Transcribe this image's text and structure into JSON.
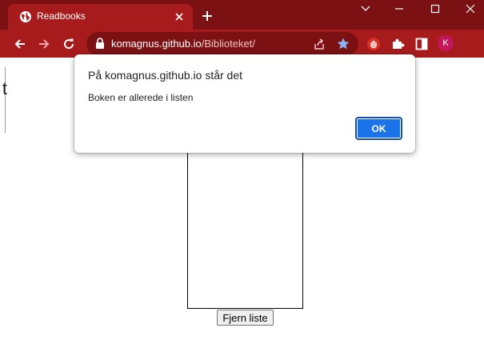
{
  "browser": {
    "tab_title": "Readbooks",
    "url_host": "komagnus.github.io",
    "url_path": "/Biblioteket/",
    "avatar_letter": "K"
  },
  "page": {
    "edge_char": "t",
    "remove_list_button": "Fjern liste"
  },
  "dialog": {
    "title": "På komagnus.github.io står det",
    "message": "Boken er allerede i listen",
    "ok_label": "OK"
  },
  "colors": {
    "titlebar": "#7b1113",
    "toolbar": "#a81b1d",
    "ok_button": "#1a73e8"
  },
  "icons": [
    "globe-icon",
    "close-icon",
    "plus-icon",
    "minimize-icon",
    "maximize-icon",
    "close-window-icon",
    "back-icon",
    "forward-icon",
    "reload-icon",
    "lock-icon",
    "share-icon",
    "star-icon",
    "extension-red-icon",
    "puzzle-icon",
    "sidepanel-icon"
  ]
}
